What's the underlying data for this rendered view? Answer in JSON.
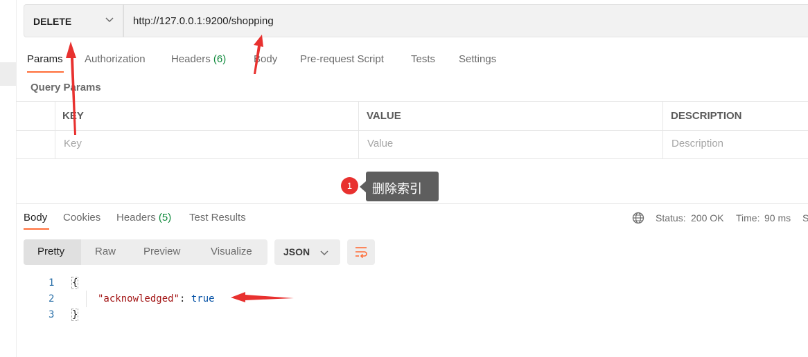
{
  "request": {
    "method": "DELETE",
    "url": "http://127.0.0.1:9200/shopping"
  },
  "request_tabs": [
    {
      "label": "Params",
      "badge": ""
    },
    {
      "label": "Authorization",
      "badge": ""
    },
    {
      "label": "Headers",
      "badge": "(6)"
    },
    {
      "label": "Body",
      "badge": ""
    },
    {
      "label": "Pre-request Script",
      "badge": ""
    },
    {
      "label": "Tests",
      "badge": ""
    },
    {
      "label": "Settings",
      "badge": ""
    }
  ],
  "query_params": {
    "title": "Query Params",
    "columns": [
      "KEY",
      "VALUE",
      "DESCRIPTION"
    ],
    "placeholders": [
      "Key",
      "Value",
      "Description"
    ]
  },
  "annotation": {
    "badge_number": "1",
    "tooltip": "删除索引"
  },
  "response_tabs": [
    {
      "label": "Body",
      "badge": ""
    },
    {
      "label": "Cookies",
      "badge": ""
    },
    {
      "label": "Headers",
      "badge": "(5)"
    },
    {
      "label": "Test Results",
      "badge": ""
    }
  ],
  "response_status": {
    "status_label": "Status:",
    "status_value": "200 OK",
    "time_label": "Time:",
    "time_value": "90 ms",
    "overflow": "S"
  },
  "view_modes": [
    "Pretty",
    "Raw",
    "Preview",
    "Visualize"
  ],
  "format": "JSON",
  "code_lines": {
    "numbers": [
      "1",
      "2",
      "3"
    ],
    "open_brace": "{",
    "key": "\"acknowledged\"",
    "colon": ": ",
    "value": "true",
    "close_brace": "}"
  },
  "colors": {
    "accent": "#ff6c37",
    "status_green": "#0f8a3c",
    "annotation_red": "#e8312f",
    "tooltip_bg": "#5e5e5e"
  }
}
